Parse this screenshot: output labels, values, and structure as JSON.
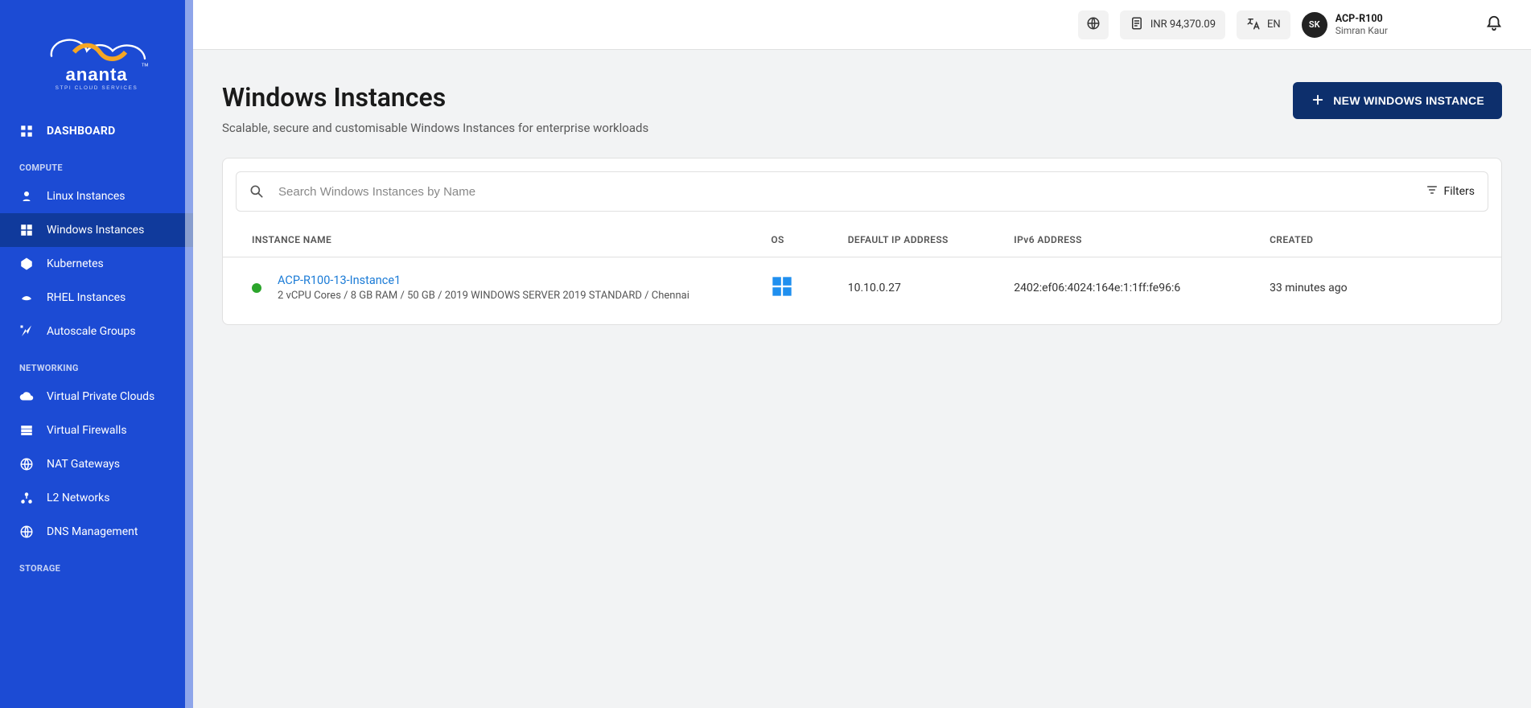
{
  "brand": {
    "name": "ananta",
    "tagline": "STPI CLOUD SERVICES"
  },
  "sidebar": {
    "dashboard_label": "DASHBOARD",
    "sections": {
      "compute": "COMPUTE",
      "networking": "NETWORKING",
      "storage": "STORAGE"
    },
    "items": {
      "linux": "Linux Instances",
      "windows": "Windows Instances",
      "kubernetes": "Kubernetes",
      "rhel": "RHEL Instances",
      "autoscale": "Autoscale Groups",
      "vpc": "Virtual Private Clouds",
      "vfw": "Virtual Firewalls",
      "nat": "NAT Gateways",
      "l2": "L2 Networks",
      "dns": "DNS Management"
    }
  },
  "topbar": {
    "balance": "INR 94,370.09",
    "lang": "EN",
    "avatar_initials": "SK",
    "account_id": "ACP-R100",
    "user_name": "Simran Kaur"
  },
  "page": {
    "title": "Windows Instances",
    "subtitle": "Scalable, secure and customisable Windows Instances for enterprise workloads",
    "new_button": "NEW WINDOWS INSTANCE"
  },
  "search": {
    "placeholder": "Search Windows Instances by Name",
    "filters_label": "Filters"
  },
  "table": {
    "headers": {
      "name": "INSTANCE NAME",
      "os": "OS",
      "ip": "DEFAULT IP ADDRESS",
      "ipv6": "IPv6 ADDRESS",
      "created": "CREATED"
    },
    "rows": [
      {
        "name": "ACP-R100-13-Instance1",
        "meta": "2 vCPU Cores / 8 GB RAM / 50 GB / 2019 WINDOWS SERVER 2019 STANDARD / Chennai",
        "os_icon": "windows",
        "ip": "10.10.0.27",
        "ipv6": "2402:ef06:4024:164e:1:1ff:fe96:6",
        "created": "33 minutes ago",
        "status": "running"
      }
    ]
  }
}
